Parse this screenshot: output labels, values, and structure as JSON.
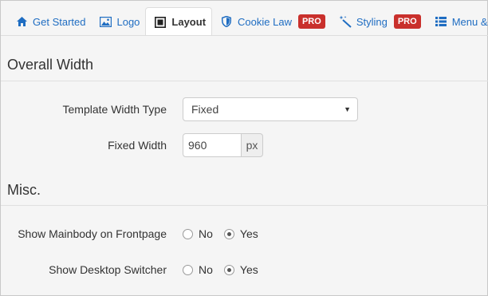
{
  "tabs": [
    {
      "label": "Get Started",
      "icon": "home-icon"
    },
    {
      "label": "Logo",
      "icon": "image-icon"
    },
    {
      "label": "Layout",
      "icon": "layout-icon"
    },
    {
      "label": "Cookie Law",
      "icon": "shield-icon",
      "badge": "PRO"
    },
    {
      "label": "Styling",
      "icon": "magic-wand-icon",
      "badge": "PRO"
    },
    {
      "label": "Menu & Site",
      "icon": "list-icon"
    }
  ],
  "overall_width": {
    "title": "Overall Width",
    "template_width_type_label": "Template Width Type",
    "template_width_type_value": "Fixed",
    "fixed_width_label": "Fixed Width",
    "fixed_width_value": "960",
    "fixed_width_unit": "px"
  },
  "misc": {
    "title": "Misc.",
    "show_mainbody_label": "Show Mainbody on Frontpage",
    "show_desktop_switcher_label": "Show Desktop Switcher",
    "option_no": "No",
    "option_yes": "Yes",
    "show_mainbody_selected": "Yes",
    "show_desktop_switcher_selected": "Yes"
  },
  "colors": {
    "link": "#1f6dc2",
    "pro_badge": "#c9302c"
  }
}
